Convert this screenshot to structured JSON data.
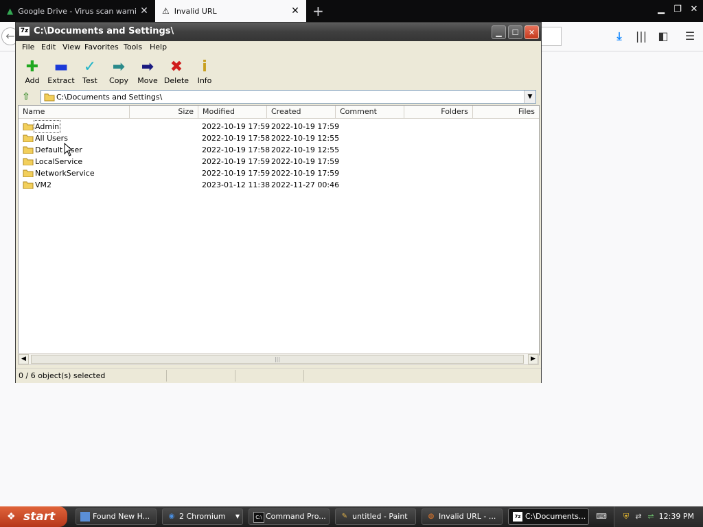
{
  "browser": {
    "tabs": [
      {
        "label": "Google Drive - Virus scan warning",
        "icon": "google-drive-icon",
        "active": false
      },
      {
        "label": "Invalid URL",
        "icon": "warning-icon",
        "active": true
      }
    ]
  },
  "window": {
    "title": "C:\\Documents and Settings\\",
    "menu": [
      "File",
      "Edit",
      "View",
      "Favorites",
      "Tools",
      "Help"
    ],
    "toolbar": {
      "add": "Add",
      "extract": "Extract",
      "test": "Test",
      "copy": "Copy",
      "move": "Move",
      "delete": "Delete",
      "info": "Info"
    },
    "address": "C:\\Documents and Settings\\",
    "columns": {
      "name": "Name",
      "size": "Size",
      "modified": "Modified",
      "created": "Created",
      "comment": "Comment",
      "folders": "Folders",
      "files": "Files"
    },
    "rows": [
      {
        "name": "Admin",
        "modified": "2022-10-19 17:59",
        "created": "2022-10-19 17:59"
      },
      {
        "name": "All Users",
        "modified": "2022-10-19 17:58",
        "created": "2022-10-19 12:55"
      },
      {
        "name": "Default User",
        "modified": "2022-10-19 17:58",
        "created": "2022-10-19 12:55"
      },
      {
        "name": "LocalService",
        "modified": "2022-10-19 17:59",
        "created": "2022-10-19 17:59"
      },
      {
        "name": "NetworkService",
        "modified": "2022-10-19 17:59",
        "created": "2022-10-19 17:59"
      },
      {
        "name": "VM2",
        "modified": "2023-01-12 11:38",
        "created": "2022-11-27 00:46"
      }
    ],
    "status": "0 / 6 object(s) selected"
  },
  "taskbar": {
    "start": "start",
    "tasks": [
      {
        "label": "Found New H...",
        "icon": "notification-window-icon"
      },
      {
        "label": "2 Chromium",
        "icon": "chromium-icon"
      },
      {
        "label": "Command Pro...",
        "icon": "command-prompt-icon"
      },
      {
        "label": "untitled - Paint",
        "icon": "paint-icon"
      },
      {
        "label": "Invalid URL - ...",
        "icon": "firefox-icon"
      },
      {
        "label": "C:\\Documents...",
        "icon": "7zip-icon"
      }
    ],
    "clock": "12:39 PM"
  },
  "colors": {
    "accent": "#0a84ff",
    "start_button": "#c84a24",
    "titlebar": "#4a4a4a",
    "folder": "#f2cf5b"
  }
}
